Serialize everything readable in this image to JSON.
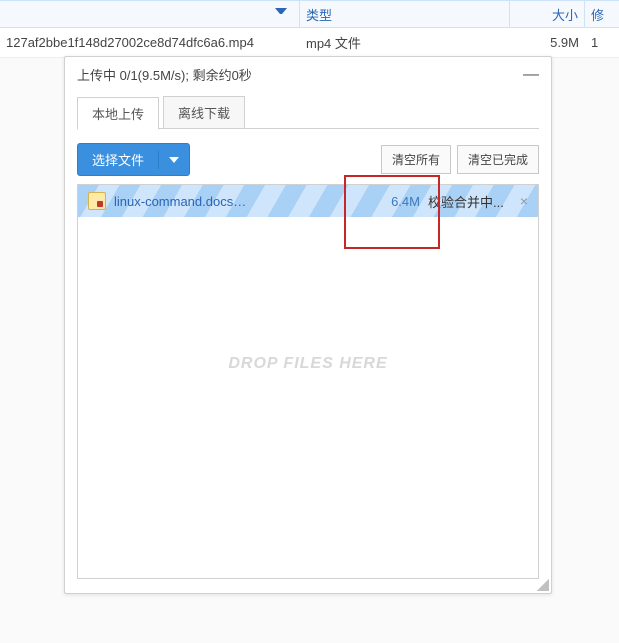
{
  "table": {
    "headers": {
      "name": "",
      "type": "类型",
      "size": "大小",
      "extra": "修"
    },
    "rows": [
      {
        "name": "127af2bbe1f148d27002ce8d74dfc6a6.mp4",
        "type": "mp4 文件",
        "size": "5.9M",
        "extra": "1"
      }
    ]
  },
  "panel": {
    "status": "上传中 0/1(9.5M/s); 剩余约0秒",
    "minimize_glyph": "—",
    "tabs": {
      "local": "本地上传",
      "remote": "离线下载"
    },
    "select_file": "选择文件",
    "clear_all": "清空所有",
    "clear_done": "清空已完成",
    "drop_placeholder": "DROP FILES HERE",
    "upload_item": {
      "name": "linux-command.docs…",
      "size": "6.4M",
      "status": "校验合并中...",
      "close": "×"
    }
  }
}
